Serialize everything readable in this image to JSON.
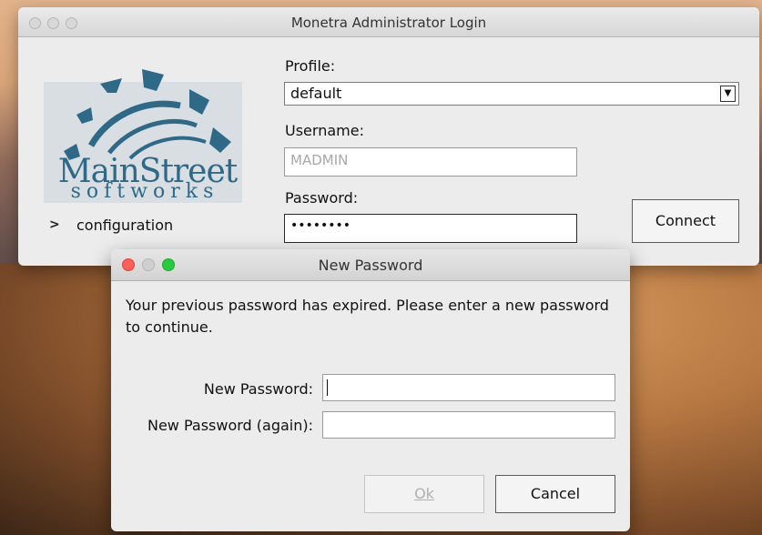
{
  "main_window": {
    "title": "Monetra Administrator Login",
    "logo": {
      "main": "MainStreet",
      "sub": "softworks"
    },
    "config_label": "configuration",
    "profile": {
      "label": "Profile:",
      "value": "default"
    },
    "username": {
      "label": "Username:",
      "placeholder": "MADMIN"
    },
    "password": {
      "label": "Password:",
      "value": "••••••••"
    },
    "connect_label": "Connect"
  },
  "dialog": {
    "title": "New Password",
    "message": "Your previous password has expired. Please enter a new password to continue.",
    "new_password_label": "New Password:",
    "new_password_again_label": "New Password (again):",
    "ok_label": "Ok",
    "cancel_label": "Cancel"
  },
  "colors": {
    "close_red": "#fe5f57",
    "minimize_gray": "#cfcfcf",
    "zoom_green": "#29c940",
    "logo_blue": "#2e6a87"
  }
}
